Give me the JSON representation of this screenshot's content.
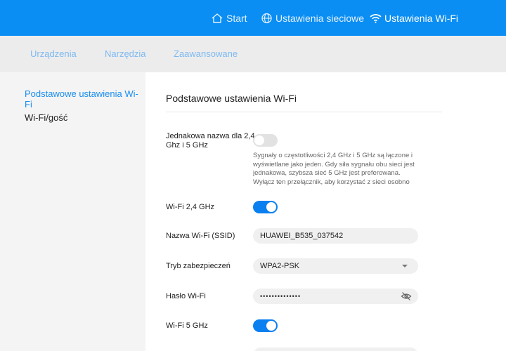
{
  "header": {
    "nav": [
      {
        "label": "Start",
        "icon": "home-icon"
      },
      {
        "label": "Ustawienia sieciowe",
        "icon": "globe-icon"
      },
      {
        "label": "Ustawienia Wi-Fi",
        "icon": "wifi-icon"
      }
    ],
    "active": "Ustawienia Wi-Fi",
    "accent": "#0a8ef3"
  },
  "subnav": [
    "Urządzenia",
    "Narzędzia",
    "Zaawansowane"
  ],
  "sidebar": {
    "items": [
      "Podstawowe ustawienia Wi-Fi",
      "Wi-Fi/gość"
    ],
    "active": "Podstawowe ustawienia Wi-Fi"
  },
  "main": {
    "title": "Podstawowe ustawienia Wi-Fi",
    "same_name": {
      "label_line1": "Jednakowa nazwa dla 2,4",
      "label_line2": "Ghz i 5 GHz",
      "enabled": false,
      "help": [
        "Sygnały o częstotliwości 2,4 GHz i 5 GHz są łączone i",
        "wyświetlane jako jeden. Gdy siła sygnału obu sieci jest",
        "jednakowa, szybsza sieć 5 GHz jest preferowana.",
        "Wyłącz ten przełącznik, aby korzystać z sieci osobno"
      ]
    },
    "wifi24": {
      "label": "Wi-Fi 2,4 GHz",
      "enabled": true
    },
    "ssid": {
      "label": "Nazwa Wi-Fi (SSID)",
      "value": "HUAWEI_B535_037542"
    },
    "security": {
      "label": "Tryb zabezpieczeń",
      "value": "WPA2-PSK"
    },
    "password": {
      "label": "Hasło Wi-Fi",
      "value": "••••••••••••••"
    },
    "wifi5": {
      "label": "Wi-Fi 5 GHz",
      "enabled": true
    }
  }
}
